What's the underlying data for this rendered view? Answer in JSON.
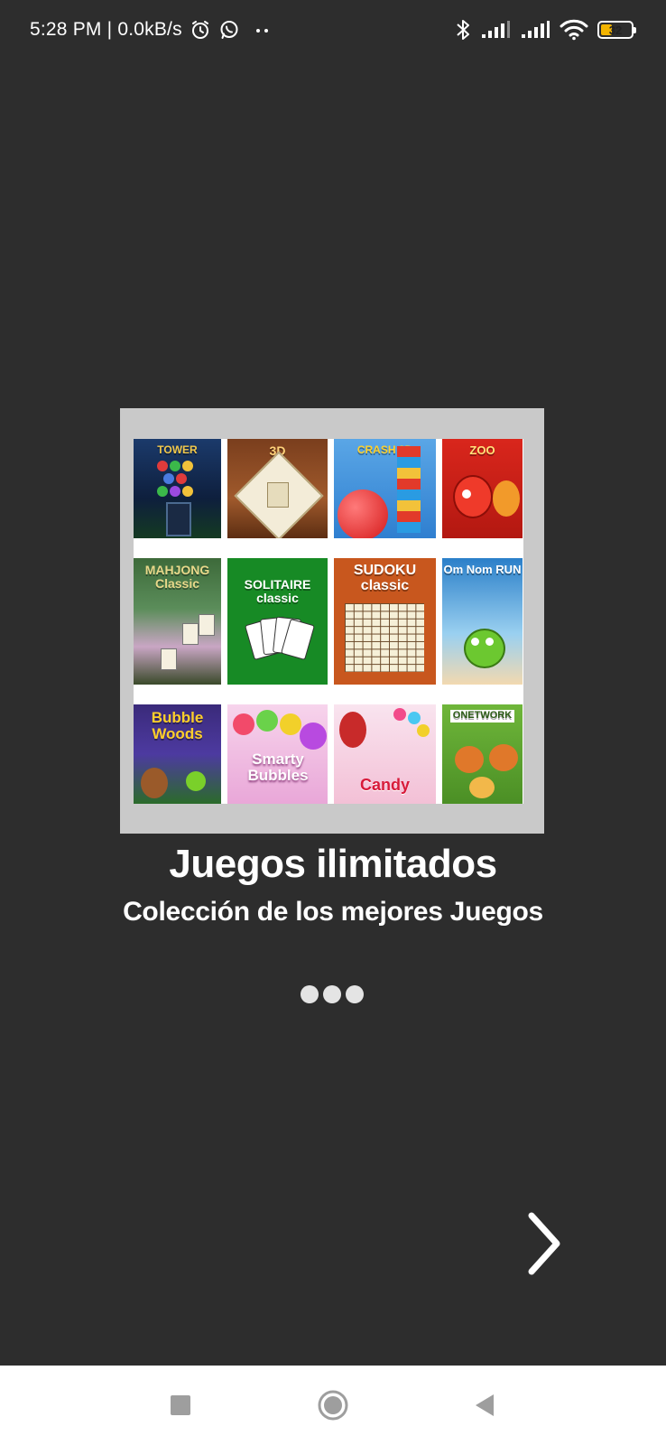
{
  "status_bar": {
    "time": "5:28 PM | 0.0kB/s",
    "battery": "32",
    "colors": {
      "battery_fill": "#f2b400"
    },
    "icons": [
      "alarm-icon",
      "whatsapp-icon",
      "more-dots-icon",
      "bluetooth-icon",
      "signal-icon",
      "signal-icon",
      "wifi-icon",
      "battery-icon"
    ]
  },
  "preview": {
    "tiles": [
      {
        "label": "TOWER"
      },
      {
        "label": "3D"
      },
      {
        "label": "CRASH 3D"
      },
      {
        "label": "ZOO"
      },
      {
        "label": "MAHJONG Classic"
      },
      {
        "label": "SOLITAIRE classic"
      },
      {
        "label": "SUDOKU classic"
      },
      {
        "label": "Om Nom RUN"
      },
      {
        "label": "Bubble Woods"
      },
      {
        "label": "Smarty Bubbles"
      },
      {
        "label": "Candy"
      },
      {
        "label": "ONETWORK"
      }
    ]
  },
  "main": {
    "title": "Juegos ilimitados",
    "subtitle": "Colección de los mejores Juegos"
  },
  "pager": {
    "count": 3,
    "active": 0
  },
  "controls": {
    "next_icon": "chevron-right-icon"
  },
  "nav_bar": {
    "buttons": [
      "recents-button",
      "home-button",
      "back-button"
    ]
  }
}
